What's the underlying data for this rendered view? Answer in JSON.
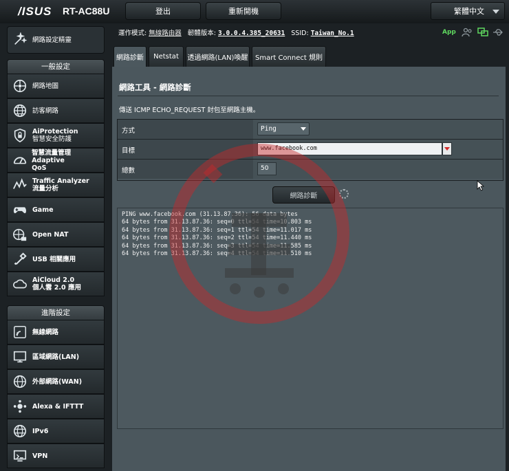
{
  "header": {
    "brand": "/ISUS",
    "model": "RT-AC88U",
    "logout": "登出",
    "reboot": "重新開機",
    "language": "繁體中文"
  },
  "sidebar": {
    "quick_setup": "網路設定精靈",
    "general_title": "一般設定",
    "general_items": [
      {
        "label": "網路地圖",
        "icon": "map-icon"
      },
      {
        "label": "訪客網路",
        "icon": "globe-icon"
      },
      {
        "label": "AiProtection",
        "sub": "智慧安全防護",
        "icon": "shield-icon"
      },
      {
        "label": "智慧流量管理 Adaptive",
        "sub": "QoS",
        "icon": "gauge-icon"
      },
      {
        "label": "Traffic Analyzer",
        "sub": "流量分析",
        "icon": "analyzer-icon"
      },
      {
        "label": "Game",
        "icon": "gamepad-icon"
      },
      {
        "label": "Open NAT",
        "icon": "nat-icon"
      },
      {
        "label": "USB 相關應用",
        "icon": "usb-icon"
      },
      {
        "label": "AiCloud 2.0",
        "sub": "個人雲 2.0 應用",
        "icon": "cloud-icon"
      }
    ],
    "advanced_title": "進階設定",
    "advanced_items": [
      {
        "label": "無線網路",
        "icon": "wifi-icon"
      },
      {
        "label": "區域網路(LAN)",
        "icon": "lan-icon"
      },
      {
        "label": "外部網路(WAN)",
        "icon": "wan-icon"
      },
      {
        "label": "Alexa & IFTTT",
        "icon": "alexa-icon"
      },
      {
        "label": "IPv6",
        "icon": "ipv6-icon"
      },
      {
        "label": "VPN",
        "icon": "vpn-icon"
      }
    ]
  },
  "status": {
    "mode_label": "運作模式:",
    "mode_value": "無線路由器",
    "fw_label": "韌體版本:",
    "fw_value": "3.0.0.4.385_20631",
    "ssid_label": "SSID:",
    "ssid_value": "Taiwan_No.1",
    "app": "App"
  },
  "tabs": [
    "網路診斷",
    "Netstat",
    "透過網路(LAN)喚醒",
    "Smart Connect 規則"
  ],
  "panel": {
    "title": "網路工具 - 網路診斷",
    "description": "傳送 ICMP ECHO_REQUEST 封包至網路主機。",
    "method_label": "方式",
    "method_value": "Ping",
    "target_label": "目標",
    "target_value": "www.facebook.com",
    "count_label": "總數",
    "count_value": "50",
    "diagnose_button": "網路診斷",
    "output_lines": [
      "PING www.facebook.com (31.13.87.36): 56 data bytes",
      "64 bytes from 31.13.87.36: seq=0 ttl=54 time=10.803 ms",
      "64 bytes from 31.13.87.36: seq=1 ttl=54 time=11.017 ms",
      "64 bytes from 31.13.87.36: seq=2 ttl=54 time=11.440 ms",
      "64 bytes from 31.13.87.36: seq=3 ttl=54 time=11.585 ms",
      "64 bytes from 31.13.87.36: seq=4 ttl=54 time=11.510 ms"
    ]
  },
  "colors": {
    "accent_green": "#5fd85f",
    "watermark_red": "#c8282a",
    "panel_bg": "#4b575d"
  }
}
